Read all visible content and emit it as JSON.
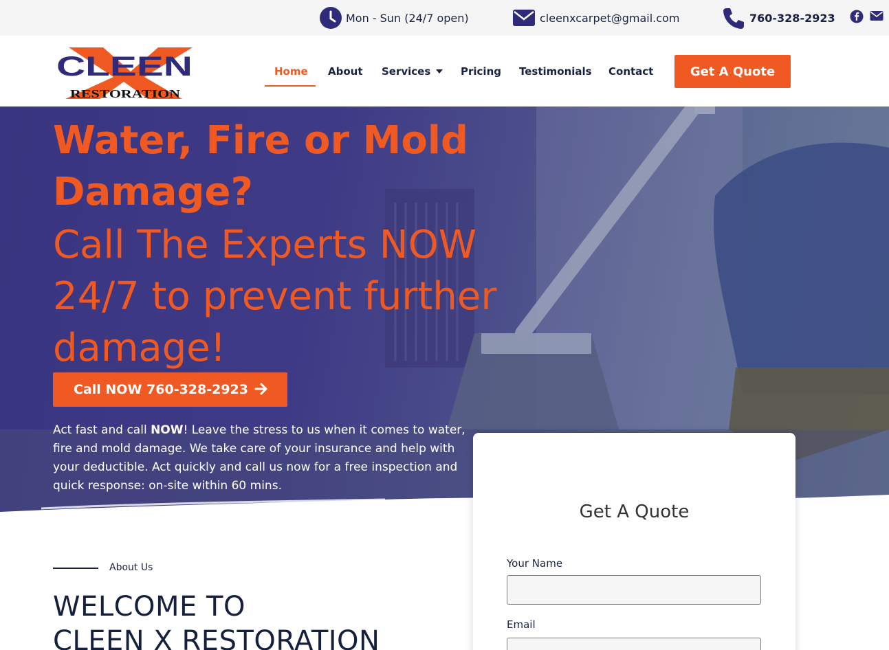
{
  "topbar": {
    "hours": "Mon - Sun (24/7 open)",
    "email": "cleenxcarpet@gmail.com",
    "phone": "760-328-2923",
    "icons": [
      "clock-icon",
      "envelope-icon",
      "phone-icon",
      "facebook-icon",
      "mail-icon"
    ]
  },
  "header": {
    "logo_text": "CLEEN",
    "logo_sub": "RESTORATION",
    "nav": [
      {
        "label": "Home",
        "active": true
      },
      {
        "label": "About"
      },
      {
        "label": "Services"
      },
      {
        "label": "Pricing"
      },
      {
        "label": "Testimonials"
      },
      {
        "label": "Contact"
      }
    ],
    "quote_button": "Get A Quote"
  },
  "hero": {
    "title": "Water, Fire or Mold Damage?",
    "subtitle": "Call The Experts NOW 24/7 to prevent further damage!",
    "call_button": "Call NOW 760-328-2923",
    "body_pre": "Act fast and call ",
    "body_bold": "NOW",
    "body_post": "! Leave the stress to us when it comes to water, fire and mold damage. We take care of your  insurance and help with your deductible. Act quickly and call us now for a free inspection and  quick response: on-site within 60 mins."
  },
  "about": {
    "label": "About Us",
    "heading_line1": "WELCOME TO",
    "heading_line2": "CLEEN X RESTORATION"
  },
  "quote_form": {
    "title": "Get A Quote",
    "name_label": "Your Name",
    "email_label": "Email"
  },
  "colors": {
    "accent": "#f05a22",
    "navy": "#1b2140",
    "hero_overlay": "#3a3580"
  }
}
